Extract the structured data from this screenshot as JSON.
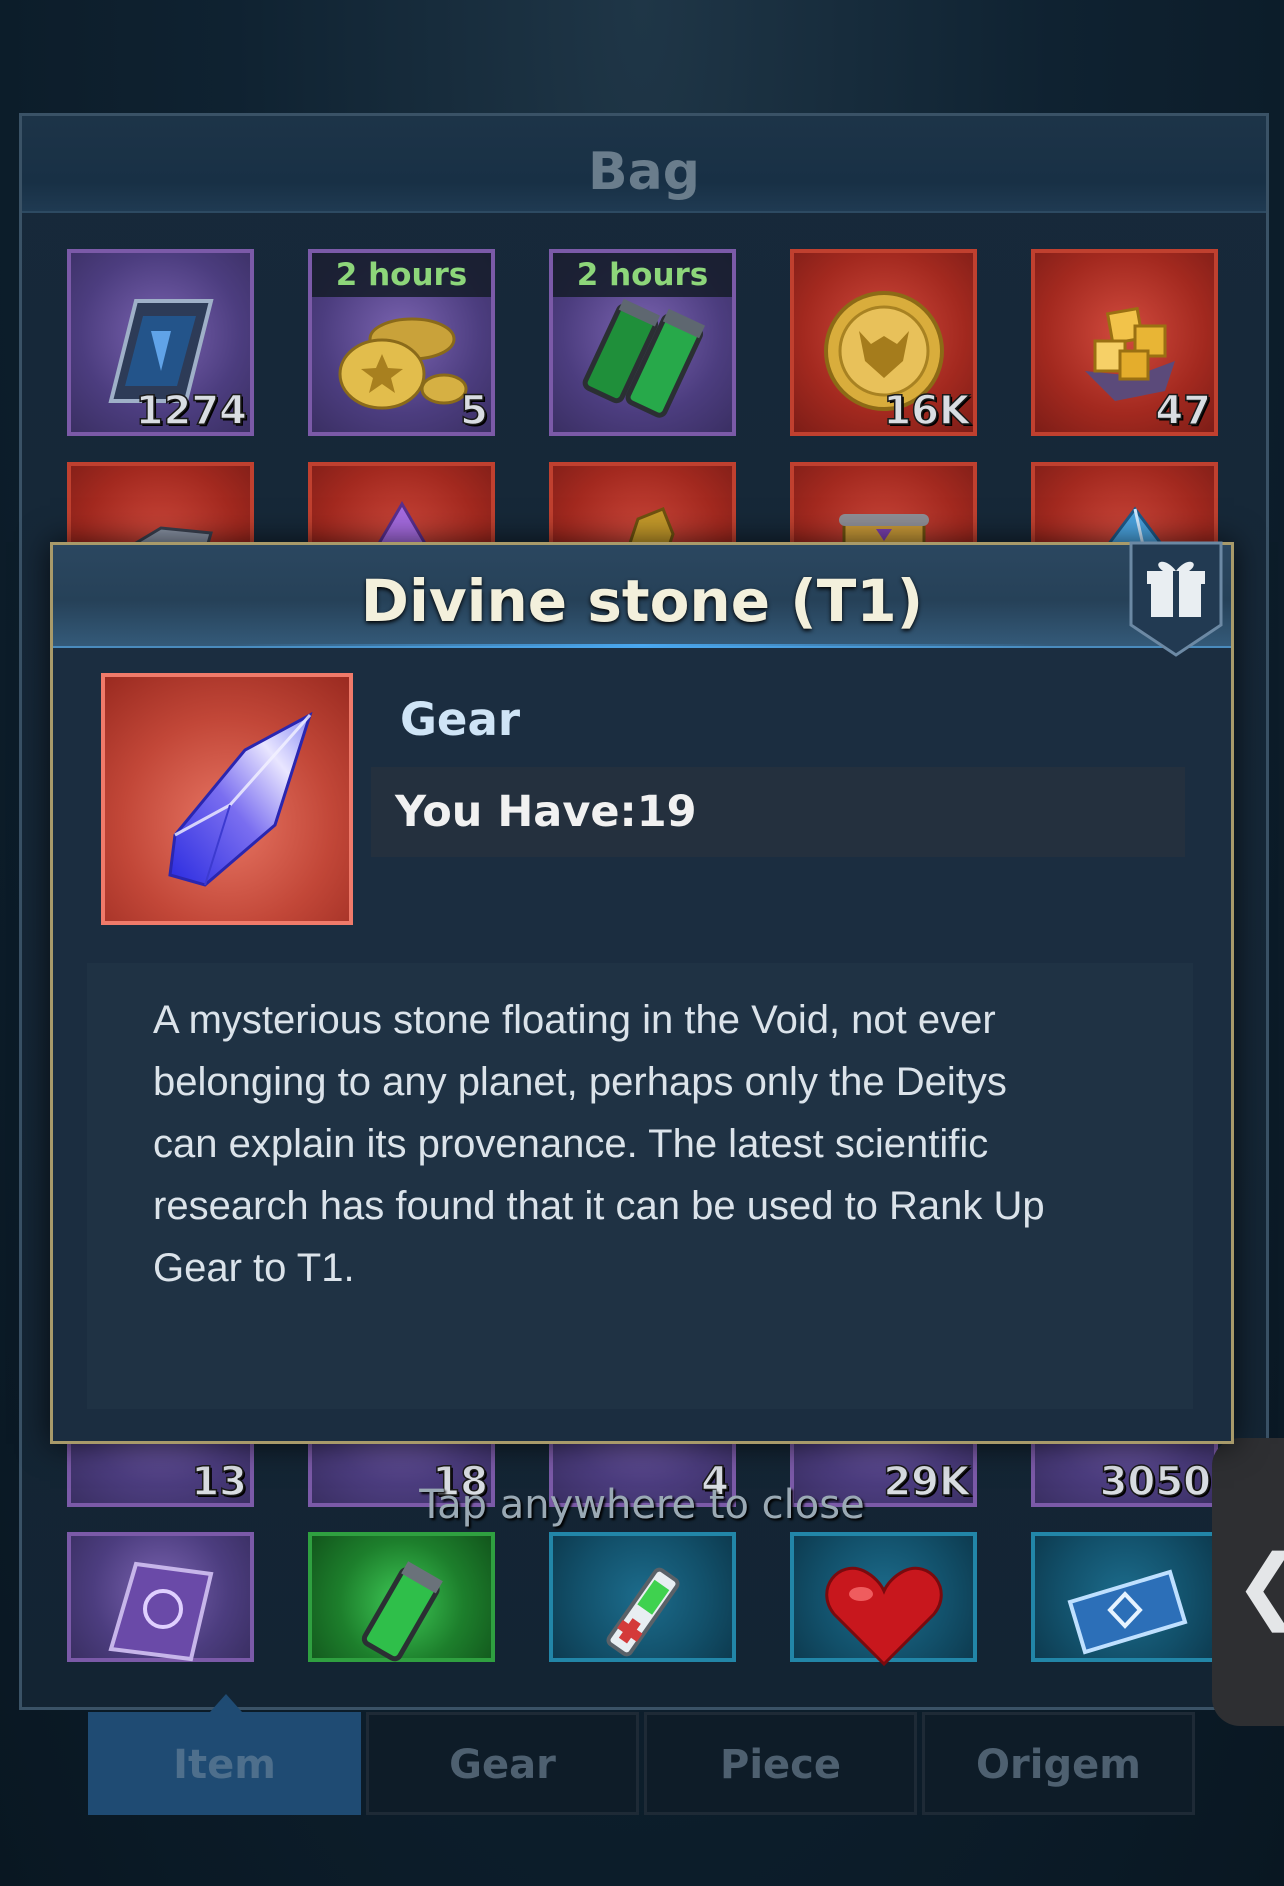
{
  "bag": {
    "title": "Bag",
    "row1": [
      {
        "rarity": "purple",
        "icon": "card-icon",
        "timer": "",
        "count": "1274"
      },
      {
        "rarity": "purple",
        "icon": "gold-coins-icon",
        "timer": "2 hours",
        "count": "5"
      },
      {
        "rarity": "purple",
        "icon": "green-canisters-icon",
        "timer": "2 hours",
        "count": ""
      },
      {
        "rarity": "red",
        "icon": "gold-medal-icon",
        "timer": "",
        "count": "16K"
      },
      {
        "rarity": "red",
        "icon": "gold-ore-icon",
        "timer": "",
        "count": "47"
      }
    ],
    "row2_icons": [
      "grey-crystal-icon",
      "purple-crystal-icon",
      "gold-armor-icon",
      "scroll-chest-icon",
      "blue-crystal-icon"
    ],
    "row3_counts": [
      "13",
      "18",
      "4",
      "29K",
      "3050"
    ],
    "row4": [
      {
        "rarity": "purple",
        "icon": "purple-card-icon"
      },
      {
        "rarity": "green",
        "icon": "green-canister-icon"
      },
      {
        "rarity": "blue",
        "icon": "medkit-vial-icon"
      },
      {
        "rarity": "blue",
        "icon": "heart-icon"
      },
      {
        "rarity": "blue",
        "icon": "blue-ticket-icon"
      }
    ]
  },
  "close_hint": "Tap anywhere to close",
  "tabs": [
    {
      "label": "Item",
      "active": true
    },
    {
      "label": "Gear",
      "active": false
    },
    {
      "label": "Piece",
      "active": false
    },
    {
      "label": "Origem",
      "active": false
    }
  ],
  "popup": {
    "title": "Divine stone (T1)",
    "badge_icon": "gift-icon",
    "item_icon": "divine-stone-crystal-icon",
    "type": "Gear",
    "you_have": "You Have:19",
    "description_lines": [
      "A mysterious stone floating in the Void, not ever",
      "belonging to any planet, perhaps only the Deitys",
      "can explain its provenance. The latest scientific",
      "research has found that it can be used to Rank Up",
      "Gear to T1."
    ]
  },
  "colors": {
    "frame_gold": "#a89a6a",
    "tab_active": "#1f4b73",
    "timer_green": "#8dd67a"
  }
}
